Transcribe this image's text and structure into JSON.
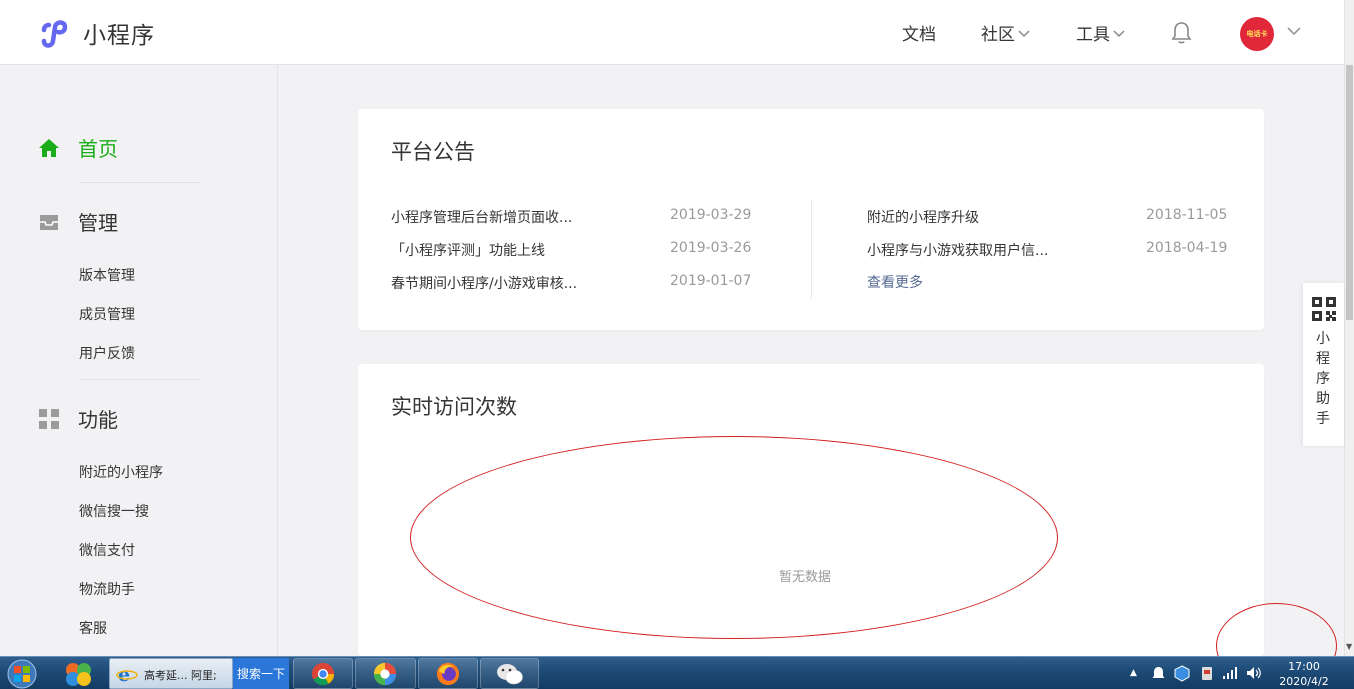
{
  "header": {
    "app_name": "小程序",
    "nav": {
      "docs": "文档",
      "community": "社区",
      "tools": "工具"
    },
    "avatar_text": "电话卡",
    "accent_color": "#1aad19"
  },
  "sidebar": {
    "home": "首页",
    "manage": {
      "title": "管理",
      "items": [
        "版本管理",
        "成员管理",
        "用户反馈"
      ]
    },
    "features": {
      "title": "功能",
      "items": [
        "附近的小程序",
        "微信搜一搜",
        "微信支付",
        "物流助手",
        "客服"
      ]
    }
  },
  "announcements": {
    "title": "平台公告",
    "left": [
      {
        "text": "小程序管理后台新增页面收...",
        "date": "2019-03-29"
      },
      {
        "text": "「小程序评测」功能上线",
        "date": "2019-03-26"
      },
      {
        "text": "春节期间小程序/小游戏审核...",
        "date": "2019-01-07"
      }
    ],
    "right": [
      {
        "text": "附近的小程序升级",
        "date": "2018-11-05"
      },
      {
        "text": "小程序与小游戏获取用户信...",
        "date": "2018-04-19"
      }
    ],
    "more": "查看更多"
  },
  "realtime": {
    "title": "实时访问次数",
    "empty": "暂无数据"
  },
  "assistant": {
    "label": "小程序助手"
  },
  "taskbar": {
    "ie_label": "高考延... 阿里;",
    "search_label": "搜索一下",
    "clock_time": "17:00",
    "clock_date": "2020/4/2"
  }
}
